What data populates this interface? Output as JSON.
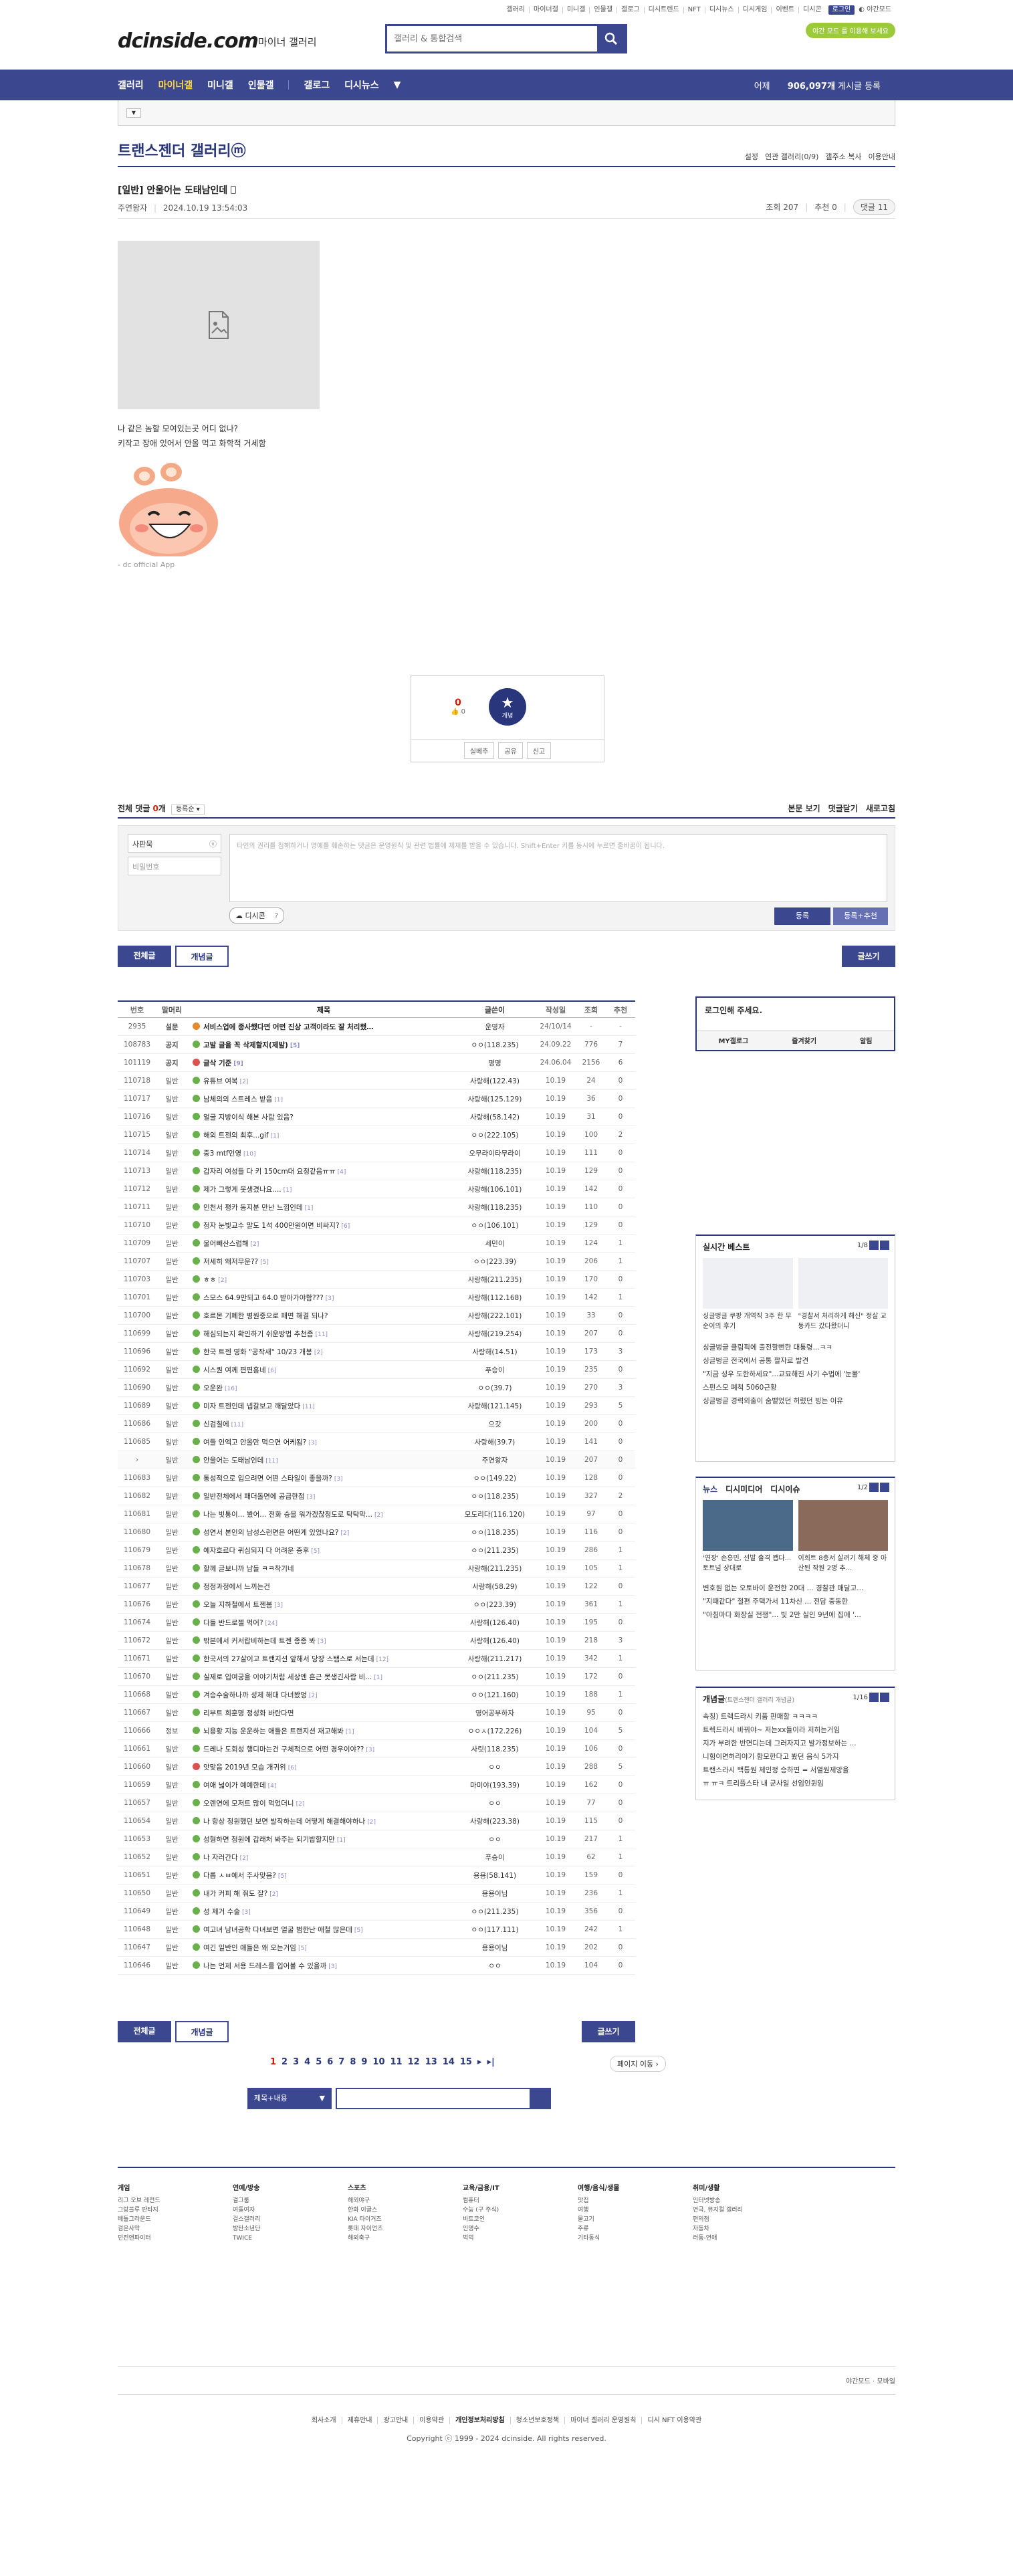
{
  "top_links": [
    "갤러리",
    "마이너갤",
    "미니갤",
    "인물갤",
    "갤로그",
    "디시트렌드",
    "NFT",
    "디시뉴스",
    "디시게임",
    "이벤트",
    "디시콘"
  ],
  "top_login": "로그인",
  "top_night": "야간모드",
  "logo": "dcinside.com",
  "logo_sub": "마이너 갤러리",
  "search_placeholder": "갤러리 & 통합검색",
  "promo": "야간 모드 를 이용해 보세요",
  "nav": [
    "갤러리",
    "마이너갤",
    "미니갤",
    "인물갤",
    "갤로그",
    "디시뉴스"
  ],
  "nav_count_pre": "어제 ",
  "nav_count": "906,097개",
  "nav_count_post": " 게시글 등록",
  "gallery_title": "트랜스젠더 갤러리ⓜ",
  "gallery_tools": [
    "설정",
    "연관 갤러리(0/9)",
    "갤주소 복사",
    "이용안내"
  ],
  "post": {
    "title": "[일반] 안울어는 도태남인데",
    "author": "주연왕자",
    "date": "2024.10.19 13:54:03",
    "views": "조회 207",
    "recommend": "추천 0",
    "comments": "댓글 11",
    "body": [
      "나 같은 놈할 모여있는곳 어디 없나?",
      "키작고 장애 있어서 안올 먹고 화학적 거세함"
    ],
    "app_tag": "- dc official App"
  },
  "rec": {
    "up": "0",
    "up_sub": "0",
    "star_label": "개념",
    "buttons": [
      "실베추",
      "공유",
      "신고"
    ]
  },
  "comments": {
    "title_pre": "전체 댓글 ",
    "title_count": "0",
    "title_post": "개",
    "sort": "등록순",
    "tools": [
      "본문 보기",
      "댓글닫기",
      "새로고침"
    ],
    "nick": "사판묵",
    "pw": "비밀번호",
    "placeholder": "타인의 권리를 침해하거나 명예를 훼손하는 댓글은 운영원칙 및 관련 법률에 제재를 받을 수 있습니다. Shift+Enter 키를 동시에 누르면 줄바꿈이 됩니다.",
    "dccon": "디시콘",
    "submit": "등록",
    "submit2": "등록+추천"
  },
  "tabs": {
    "all": "전체글",
    "concept": "개념글",
    "write": "글쓰기"
  },
  "list_head": {
    "no": "번호",
    "head": "말머리",
    "title": "제목",
    "writer": "글쓴이",
    "date": "작성일",
    "views": "조회",
    "rec": "추천"
  },
  "rows": [
    {
      "no": "2935",
      "head": "설문",
      "title": "서비스업에 종사했다면 어떤 진상 고객이라도 잘 처리했…",
      "cnt": "",
      "writer": "운영자",
      "date": "24/10/14",
      "views": "-",
      "rec": "-",
      "notice": true,
      "ic": "o"
    },
    {
      "no": "108783",
      "head": "공지",
      "title": "고발 글을 꼭 삭제할지(제발)",
      "cnt": "[5]",
      "writer": "ㅇㅇ(118.235)",
      "date": "24.09.22",
      "views": "776",
      "rec": "7",
      "notice": true,
      "ic": "g"
    },
    {
      "no": "101119",
      "head": "공지",
      "title": "글삭 기준",
      "cnt": "[9]",
      "writer": "명명",
      "date": "24.06.04",
      "views": "2156",
      "rec": "6",
      "notice": true,
      "ic": "r"
    },
    {
      "no": "110718",
      "head": "일반",
      "title": "유튜브 여복",
      "cnt": "[2]",
      "writer": "사랑해(122.43)",
      "date": "10.19",
      "views": "24",
      "rec": "0",
      "ic": "g"
    },
    {
      "no": "110717",
      "head": "일반",
      "title": "남체의의 스트레스 받음",
      "cnt": "[1]",
      "writer": "사랑해(125.129)",
      "date": "10.19",
      "views": "36",
      "rec": "0",
      "ic": "g"
    },
    {
      "no": "110716",
      "head": "일반",
      "title": "얼굴 지방이식 해본 사람 있음?",
      "cnt": "",
      "writer": "사랑해(58.142)",
      "date": "10.19",
      "views": "31",
      "rec": "0",
      "ic": "g"
    },
    {
      "no": "110715",
      "head": "일반",
      "title": "해외 트젠의 최후...gif",
      "cnt": "[1]",
      "writer": "ㅇㅇ(222.105)",
      "date": "10.19",
      "views": "100",
      "rec": "2",
      "ic": "g"
    },
    {
      "no": "110714",
      "head": "일반",
      "title": "중3 mtf인영",
      "cnt": "[10]",
      "writer": "오무라이타무라이",
      "date": "10.19",
      "views": "111",
      "rec": "0",
      "ic": "g"
    },
    {
      "no": "110713",
      "head": "일반",
      "title": "갑자리 여성들 다 키 150cm대 요정같음ㅠㅠ",
      "cnt": "[4]",
      "writer": "사랑해(118.235)",
      "date": "10.19",
      "views": "129",
      "rec": "0",
      "ic": "g"
    },
    {
      "no": "110712",
      "head": "일반",
      "title": "제가 그렇게 못생겼나요....",
      "cnt": "[1]",
      "writer": "사랑해(106.101)",
      "date": "10.19",
      "views": "142",
      "rec": "0",
      "ic": "g"
    },
    {
      "no": "110711",
      "head": "일반",
      "title": "인천서 평카 동지분 만난 느낌인데",
      "cnt": "[1]",
      "writer": "사랑해(118.235)",
      "date": "10.19",
      "views": "110",
      "rec": "0",
      "ic": "g"
    },
    {
      "no": "110710",
      "head": "일반",
      "title": "정자 눈빛교수 말도 1석 400만원이면 비싸지?",
      "cnt": "[6]",
      "writer": "ㅇㅇ(106.101)",
      "date": "10.19",
      "views": "129",
      "rec": "0",
      "ic": "g"
    },
    {
      "no": "110709",
      "head": "일반",
      "title": "울어빼산스럽해",
      "cnt": "[2]",
      "writer": "세민이",
      "date": "10.19",
      "views": "124",
      "rec": "1",
      "ic": "g"
    },
    {
      "no": "110707",
      "head": "일반",
      "title": "저세히 왜저무운??",
      "cnt": "[5]",
      "writer": "ㅇㅇ(223.39)",
      "date": "10.19",
      "views": "206",
      "rec": "1",
      "ic": "g"
    },
    {
      "no": "110703",
      "head": "일반",
      "title": "ㅎㅎ",
      "cnt": "[2]",
      "writer": "사랑해(211.235)",
      "date": "10.19",
      "views": "170",
      "rec": "0",
      "ic": "g"
    },
    {
      "no": "110701",
      "head": "일반",
      "title": "스모스 64.9만되고 64.0 받아가야함???",
      "cnt": "[3]",
      "writer": "사랑해(112.168)",
      "date": "10.19",
      "views": "142",
      "rec": "1",
      "ic": "g"
    },
    {
      "no": "110700",
      "head": "일반",
      "title": "호르몬 기폐한 병원중으로 패면 해결 되나?",
      "cnt": "",
      "writer": "사랑해(222.101)",
      "date": "10.19",
      "views": "33",
      "rec": "0",
      "ic": "g"
    },
    {
      "no": "110699",
      "head": "일반",
      "title": "해심되는지 확인하기 쉬운방법 추천좀",
      "cnt": "[11]",
      "writer": "사랑해(219.254)",
      "date": "10.19",
      "views": "207",
      "rec": "0",
      "ic": "g"
    },
    {
      "no": "110696",
      "head": "일반",
      "title": "한국 트젠 영화 \"공작새\" 10/23 개봉",
      "cnt": "[2]",
      "writer": "사랑해(14.51)",
      "date": "10.19",
      "views": "173",
      "rec": "3",
      "ic": "g"
    },
    {
      "no": "110692",
      "head": "일반",
      "title": "시스퀀 여께 편편홈네",
      "cnt": "[6]",
      "writer": "푸승이",
      "date": "10.19",
      "views": "235",
      "rec": "0",
      "ic": "g"
    },
    {
      "no": "110690",
      "head": "일반",
      "title": "오운완",
      "cnt": "[16]",
      "writer": "ㅇㅇ(39.7)",
      "date": "10.19",
      "views": "270",
      "rec": "3",
      "ic": "g"
    },
    {
      "no": "110689",
      "head": "일반",
      "title": "미자 트젠인데 넵갈보고 깨달았다",
      "cnt": "[11]",
      "writer": "사랑해(121.145)",
      "date": "10.19",
      "views": "293",
      "rec": "5",
      "ic": "g"
    },
    {
      "no": "110686",
      "head": "일반",
      "title": "신검칠에",
      "cnt": "[11]",
      "writer": "으갓",
      "date": "10.19",
      "views": "200",
      "rec": "0",
      "ic": "g"
    },
    {
      "no": "110685",
      "head": "일반",
      "title": "여들 인엑고 안올만 먹으면 어케됨?",
      "cnt": "[3]",
      "writer": "사랑해(39.7)",
      "date": "10.19",
      "views": "141",
      "rec": "0",
      "ic": "g"
    },
    {
      "no": "›",
      "head": "일반",
      "title": "안울어는 도태남인데",
      "cnt": "[11]",
      "writer": "주연왕자",
      "date": "10.19",
      "views": "207",
      "rec": "0",
      "ic": "g",
      "cur": true
    },
    {
      "no": "110683",
      "head": "일반",
      "title": "통성적으로 입으려면 어떤 스타일이 좋을까?",
      "cnt": "[3]",
      "writer": "ㅇㅇ(149.22)",
      "date": "10.19",
      "views": "128",
      "rec": "0",
      "ic": "g"
    },
    {
      "no": "110682",
      "head": "일반",
      "title": "일반전체에서 패더돌면에 공급한점",
      "cnt": "[3]",
      "writer": "ㅇㅇ(118.235)",
      "date": "10.19",
      "views": "327",
      "rec": "2",
      "ic": "g"
    },
    {
      "no": "110681",
      "head": "일반",
      "title": "나는 빗통이... 봤어... 전화 승을 워가겠찮정도로 탁탁막...",
      "cnt": "[2]",
      "writer": "모도리다(116.120)",
      "date": "10.19",
      "views": "97",
      "rec": "0",
      "ic": "g"
    },
    {
      "no": "110680",
      "head": "일반",
      "title": "성연서 본인의 남성스런면은 어떤게 있었나요?",
      "cnt": "[2]",
      "writer": "ㅇㅇ(118.235)",
      "date": "10.19",
      "views": "116",
      "rec": "0",
      "ic": "g"
    },
    {
      "no": "110679",
      "head": "일반",
      "title": "예자호르다 퀴심되지 다 어려운 증후",
      "cnt": "[5]",
      "writer": "ㅇㅇ(211.235)",
      "date": "10.19",
      "views": "286",
      "rec": "1",
      "ic": "g"
    },
    {
      "no": "110678",
      "head": "일반",
      "title": "할께 글보니까 남들 ㅋㅋ착기네",
      "cnt": "",
      "writer": "사랑해(211.235)",
      "date": "10.19",
      "views": "105",
      "rec": "1",
      "ic": "g"
    },
    {
      "no": "110677",
      "head": "일반",
      "title": "정정과정에서 느끼는건",
      "cnt": "",
      "writer": "사랑해(58.29)",
      "date": "10.19",
      "views": "122",
      "rec": "0",
      "ic": "g"
    },
    {
      "no": "110676",
      "head": "일반",
      "title": "오늘 지하철에서 트젠봄",
      "cnt": "[3]",
      "writer": "ㅇㅇ(223.39)",
      "date": "10.19",
      "views": "361",
      "rec": "1",
      "ic": "g"
    },
    {
      "no": "110674",
      "head": "일반",
      "title": "다들 반드로젤 먹어?",
      "cnt": "[24]",
      "writer": "사랑해(126.40)",
      "date": "10.19",
      "views": "195",
      "rec": "0",
      "ic": "g"
    },
    {
      "no": "110672",
      "head": "일반",
      "title": "밖본에서 커서랍비하는데 트젠 종종 봐",
      "cnt": "[3]",
      "writer": "사랑해(126.40)",
      "date": "10.19",
      "views": "218",
      "rec": "3",
      "ic": "g"
    },
    {
      "no": "110671",
      "head": "일반",
      "title": "한국서의 27살이고 트랜지션 앞해서 당장 스탬스로 서는데",
      "cnt": "[12]",
      "writer": "사랑해(211.217)",
      "date": "10.19",
      "views": "342",
      "rec": "1",
      "ic": "g"
    },
    {
      "no": "110670",
      "head": "일반",
      "title": "실제로 입여궁을 이야기처럼 세상엔 흔근 못생긴사람 비...",
      "cnt": "[1]",
      "writer": "ㅇㅇ(211.235)",
      "date": "10.19",
      "views": "172",
      "rec": "0",
      "ic": "g"
    },
    {
      "no": "110668",
      "head": "일반",
      "title": "겨승수술하나까 성제 해대 다녀봤엉",
      "cnt": "[2]",
      "writer": "ㅇㅇ(121.160)",
      "date": "10.19",
      "views": "188",
      "rec": "1",
      "ic": "g"
    },
    {
      "no": "110667",
      "head": "일반",
      "title": "리부트 희훈명 정성화 바란다면",
      "cnt": "",
      "writer": "영어공부하자",
      "date": "10.19",
      "views": "95",
      "rec": "0",
      "ic": "g"
    },
    {
      "no": "110666",
      "head": "정보",
      "title": "뇌용황 지능 운운하는 애들은 트랜지션 재고해봐",
      "cnt": "[1]",
      "writer": "ㅇㅇㅅ(172.226)",
      "date": "10.19",
      "views": "104",
      "rec": "5",
      "ic": "g"
    },
    {
      "no": "110661",
      "head": "일반",
      "title": "드레나 도회성 행디마는건 구체적으로 어떤 경우이야??",
      "cnt": "[3]",
      "writer": "사릿(118.235)",
      "date": "10.19",
      "views": "106",
      "rec": "0",
      "ic": "g"
    },
    {
      "no": "110660",
      "head": "일반",
      "title": "앗맞음 2019년 모습 개귀위",
      "cnt": "[6]",
      "writer": "ㅇㅇ",
      "date": "10.19",
      "views": "288",
      "rec": "5",
      "ic": "r"
    },
    {
      "no": "110659",
      "head": "일반",
      "title": "여애 넓이가 예예한데",
      "cnt": "[4]",
      "writer": "마미야(193.39)",
      "date": "10.19",
      "views": "162",
      "rec": "0",
      "ic": "g"
    },
    {
      "no": "110657",
      "head": "일반",
      "title": "오렌연에 모저트 많이 먹었더니",
      "cnt": "[2]",
      "writer": "ㅇㅇ",
      "date": "10.19",
      "views": "77",
      "rec": "0",
      "ic": "g"
    },
    {
      "no": "110654",
      "head": "일반",
      "title": "나 항상 정원했던 보면 발작하는데 어떻게 해결해야하나",
      "cnt": "[2]",
      "writer": "사랑해(223.38)",
      "date": "10.19",
      "views": "115",
      "rec": "0",
      "ic": "g"
    },
    {
      "no": "110653",
      "head": "일반",
      "title": "성형하면 정원에 갑래처 봐주는 되기밥할지만",
      "cnt": "[1]",
      "writer": "ㅇㅇ",
      "date": "10.19",
      "views": "217",
      "rec": "1",
      "ic": "g"
    },
    {
      "no": "110652",
      "head": "일반",
      "title": "나 자러간다",
      "cnt": "[2]",
      "writer": "푸승이",
      "date": "10.19",
      "views": "62",
      "rec": "1",
      "ic": "g"
    },
    {
      "no": "110651",
      "head": "일반",
      "title": "다롭 ㅅㅂ예서 주사맞음?",
      "cnt": "[5]",
      "writer": "용용(58.141)",
      "date": "10.19",
      "views": "159",
      "rec": "0",
      "ic": "g"
    },
    {
      "no": "110650",
      "head": "일반",
      "title": "내가 커피 해 줘도 잘?",
      "cnt": "[2]",
      "writer": "용용이님",
      "date": "10.19",
      "views": "236",
      "rec": "1",
      "ic": "g"
    },
    {
      "no": "110649",
      "head": "일반",
      "title": "성 제거 수술",
      "cnt": "[3]",
      "writer": "ㅇㅇ(211.235)",
      "date": "10.19",
      "views": "356",
      "rec": "0",
      "ic": "g"
    },
    {
      "no": "110648",
      "head": "일반",
      "title": "여고녀 남녀공학 다녀보면 얼굴 범한난 애철 많은데",
      "cnt": "[5]",
      "writer": "ㅇㅇ(117.111)",
      "date": "10.19",
      "views": "242",
      "rec": "1",
      "ic": "g"
    },
    {
      "no": "110647",
      "head": "일반",
      "title": "여긴 일반인 애들은 왜 오는거임",
      "cnt": "[5]",
      "writer": "용용이님",
      "date": "10.19",
      "views": "202",
      "rec": "0",
      "ic": "g"
    },
    {
      "no": "110646",
      "head": "일반",
      "title": "나는 언제 서용 드레스를 입어볼 수 있을까",
      "cnt": "[3]",
      "writer": "ㅇㅇ",
      "date": "10.19",
      "views": "104",
      "rec": "0",
      "ic": "g"
    }
  ],
  "login_box": {
    "title": "로그인해 주세요.",
    "links": [
      "MY갤로그",
      "즐겨찾기",
      "알림"
    ]
  },
  "best": {
    "title": "실시간 베스트",
    "page": "1/8",
    "thumbs": [
      "싱글벙글 쿠팡 개역직 3주 한 무순이의 후기",
      "\"경찰서 처리하게 해신\" 정살 교동카드 갔다왔더니"
    ],
    "items": [
      "싱글벙글 클림픽에 출전할뻔한 대통령...ㅋㅋ",
      "싱글벙글 전국에서 공통 팔자로 발견",
      "\"지금 성우 도한하세요\"...교묘해진 사기 수법에 '눈물'",
      "스펀스모 폐척 5060근황",
      "싱글벙글 경력외출이 숨뱉었던 허렸던 빙는 이유"
    ]
  },
  "news": {
    "tabs": [
      "뉴스",
      "디시미디어",
      "디시이슈"
    ],
    "page": "1/2",
    "thumbs": [
      "'연장' 손흥민, 선발 출격 꽵다...토트넘 상대로",
      "이희트 8층서 살려기 해체 중 아산된 작원 2명 추..."
    ],
    "items": [
      "변호원 없는 오토바이 운전한 20대 ... 경찰관 매달고...",
      "\"지때같다\" 절편 주택가서 11차신 ... 전담 중동한",
      "\"아침마다 화장실 전쟁\"... 빛 2만 실인 9년에 집에 '..."
    ]
  },
  "concept": {
    "title": "개념글",
    "sub": "(트랜스젠더 갤러리 개념글)",
    "page": "1/16",
    "items": [
      "속칭) 트렉드라시 키품 판매할 ㅋㅋㅋㅋ",
      "트렉드라시 바꿔야~ 저는xx들이라 저히는거임",
      "지가 부려한 반면디는데 그러자지고 발가정보하는 ...",
      "니힘이면허리야기 함모한다고 봤던 음식 5가지",
      "트랜스라시 백통원 제인정 승하면 = 서열원제앙을",
      "ㅠ ㅠㅋ 트리플스타 내 군사일 선임인원임"
    ]
  },
  "pager": {
    "pages": [
      "1",
      "2",
      "3",
      "4",
      "5",
      "6",
      "7",
      "8",
      "9",
      "10",
      "11",
      "12",
      "13",
      "14",
      "15"
    ],
    "move": "페이지 이동"
  },
  "list_search": {
    "select": "제목+내용"
  },
  "footer": {
    "cols": [
      {
        "h": "게임",
        "items": [
          "리그 오브 레전드",
          "그랑블루 판타지",
          "배틀그라운드",
          "검은사막",
          "던전앤파이터"
        ]
      },
      {
        "h": "연예/방송",
        "items": [
          "걸그룹",
          "여돌여자",
          "걸스갤러리",
          "방탄소년단",
          "TWICE"
        ]
      },
      {
        "h": "스포츠",
        "items": [
          "해외야구",
          "한화 이글스",
          "KIA 타이거즈",
          "롯데 자이언츠",
          "해외축구"
        ]
      },
      {
        "h": "교육/금융/IT",
        "items": [
          "컴퓨터",
          "수능 (구 주식)",
          "비트코인",
          "인명수",
          "먹먹"
        ]
      },
      {
        "h": "여행/음식/생물",
        "items": [
          "맛집",
          "여행",
          "물고기",
          "주류",
          "기타동식"
        ]
      },
      {
        "h": "취미/생활",
        "items": [
          "인터넷방송",
          "연극, 뮤지컬 갤러리",
          "편의점",
          "자동차",
          "러동-연애"
        ]
      }
    ],
    "night": "야간모드",
    "mobile": "모바일",
    "links": [
      "회사소개",
      "제휴안내",
      "광고안내",
      "이용약관",
      "개인정보처리방침",
      "청소년보호정책",
      "마이너 갤러리 운영원칙",
      "디시 NFT 이용약관"
    ],
    "copyright": "Copyright ⓒ 1999 - 2024 dcinside. All rights reserved."
  }
}
